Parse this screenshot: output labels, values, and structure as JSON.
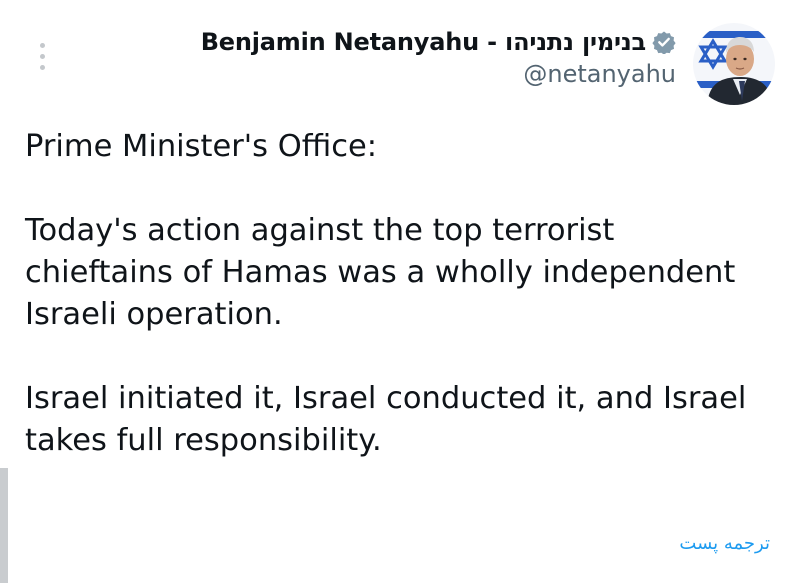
{
  "author": {
    "display_name": "Benjamin Netanyahu - בנימין נתניהו",
    "handle": "@netanyahu",
    "verified": true,
    "avatar_icon": "profile-photo-israeli-flag"
  },
  "post": {
    "paragraphs": [
      "Prime Minister's Office:",
      "Today's action against the top terrorist chieftains of Hamas was a wholly independent Israeli operation.",
      "Israel initiated it, Israel conducted it, and Israel takes full responsibility."
    ]
  },
  "actions": {
    "more_icon": "more-vertical-icon",
    "translate_label": "ترجمه پست"
  },
  "colors": {
    "text": "#0f1419",
    "secondary_text": "#536471",
    "link": "#1d9bf0",
    "verified_badge": "#829aab"
  }
}
